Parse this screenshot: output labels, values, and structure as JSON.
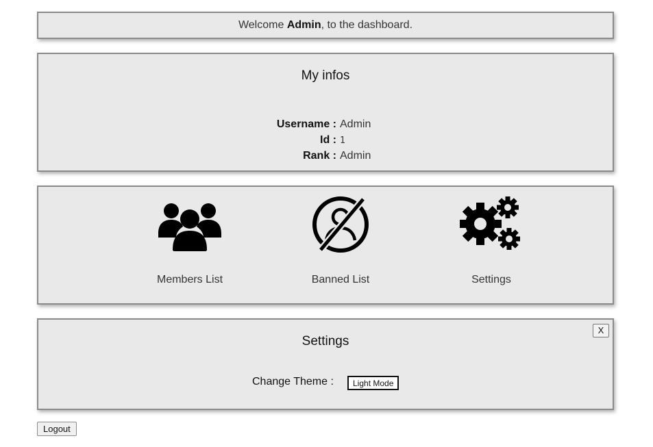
{
  "welcome": {
    "prefix": "Welcome ",
    "user": "Admin",
    "suffix": ", to the dashboard."
  },
  "infos": {
    "title": "My infos",
    "rows": [
      {
        "label": "Username :",
        "value": "Admin"
      },
      {
        "label": "Id :",
        "value": "1"
      },
      {
        "label": "Rank :",
        "value": "Admin"
      }
    ]
  },
  "menu": {
    "items": [
      {
        "label": "Members List",
        "icon": "users-group-icon"
      },
      {
        "label": "Banned List",
        "icon": "banned-user-icon"
      },
      {
        "label": "Settings",
        "icon": "gears-icon"
      }
    ]
  },
  "settings": {
    "title": "Settings",
    "close_label": "X",
    "theme_label": "Change Theme :",
    "theme_button": "Light Mode"
  },
  "logout_label": "Logout",
  "colors": {
    "panel_bg": "#e9e9e9",
    "panel_border": "#8a8a8a",
    "icon": "#000000"
  }
}
